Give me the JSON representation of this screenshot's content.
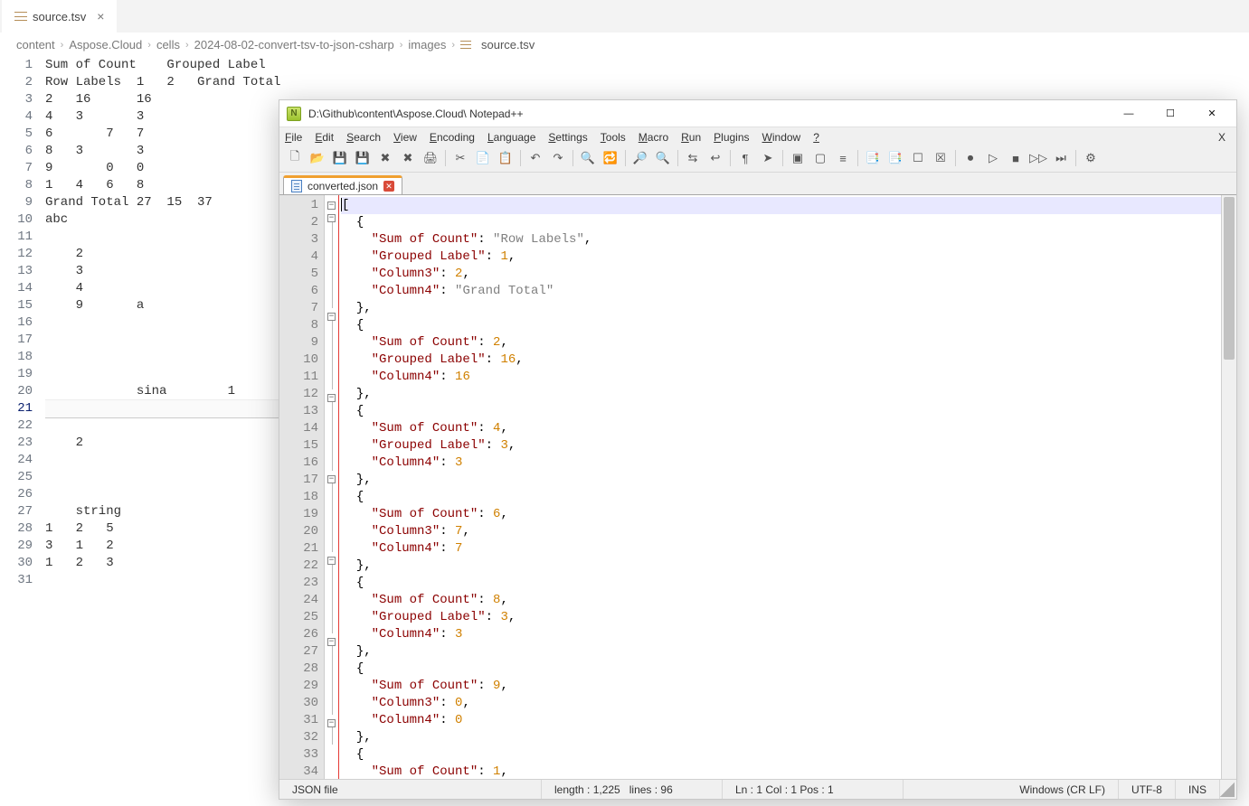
{
  "vscode": {
    "tab_name": "source.tsv",
    "breadcrumbs": [
      "content",
      "Aspose.Cloud",
      "cells",
      "2024-08-02-convert-tsv-to-json-csharp",
      "images",
      "source.tsv"
    ],
    "lines": [
      "Sum of Count    Grouped Label",
      "Row Labels  1   2   Grand Total",
      "2   16      16",
      "4   3       3",
      "6       7   7",
      "8   3       3",
      "9       0   0",
      "1   4   6   8",
      "Grand Total 27  15  37",
      "abc",
      "",
      "    2",
      "    3",
      "    4",
      "    9       a",
      "",
      "",
      "",
      "",
      "            sina        1",
      "",
      "",
      "    2",
      "",
      "",
      "",
      "    string",
      "1   2   5",
      "3   1   2",
      "1   2   3",
      ""
    ],
    "current_line": 21
  },
  "notepad": {
    "title": "D:\\Github\\content\\Aspose.Cloud\\ Notepad++",
    "menus": [
      "File",
      "Edit",
      "Search",
      "View",
      "Encoding",
      "Language",
      "Settings",
      "Tools",
      "Macro",
      "Run",
      "Plugins",
      "Window",
      "?"
    ],
    "tab_name": "converted.json",
    "json_lines": [
      {
        "n": 1,
        "fold": "box",
        "txt": [
          [
            "b",
            "["
          ]
        ]
      },
      {
        "n": 2,
        "fold": "box",
        "txt": [
          [
            "sp",
            "  "
          ],
          [
            "b",
            "{"
          ]
        ]
      },
      {
        "n": 3,
        "fold": "rail",
        "txt": [
          [
            "sp",
            "    "
          ],
          [
            "k",
            "\"Sum of Count\""
          ],
          [
            "p",
            ": "
          ],
          [
            "s",
            "\"Row Labels\""
          ],
          [
            "p",
            ","
          ]
        ]
      },
      {
        "n": 4,
        "fold": "rail",
        "txt": [
          [
            "sp",
            "    "
          ],
          [
            "k",
            "\"Grouped Label\""
          ],
          [
            "p",
            ": "
          ],
          [
            "n",
            "1"
          ],
          [
            "p",
            ","
          ]
        ]
      },
      {
        "n": 5,
        "fold": "rail",
        "txt": [
          [
            "sp",
            "    "
          ],
          [
            "k",
            "\"Column3\""
          ],
          [
            "p",
            ": "
          ],
          [
            "n",
            "2"
          ],
          [
            "p",
            ","
          ]
        ]
      },
      {
        "n": 6,
        "fold": "rail",
        "txt": [
          [
            "sp",
            "    "
          ],
          [
            "k",
            "\"Column4\""
          ],
          [
            "p",
            ": "
          ],
          [
            "s",
            "\"Grand Total\""
          ]
        ]
      },
      {
        "n": 7,
        "fold": "rail",
        "txt": [
          [
            "sp",
            "  "
          ],
          [
            "b",
            "}"
          ],
          [
            "p",
            ","
          ]
        ]
      },
      {
        "n": 8,
        "fold": "box",
        "txt": [
          [
            "sp",
            "  "
          ],
          [
            "b",
            "{"
          ]
        ]
      },
      {
        "n": 9,
        "fold": "rail",
        "txt": [
          [
            "sp",
            "    "
          ],
          [
            "k",
            "\"Sum of Count\""
          ],
          [
            "p",
            ": "
          ],
          [
            "n",
            "2"
          ],
          [
            "p",
            ","
          ]
        ]
      },
      {
        "n": 10,
        "fold": "rail",
        "txt": [
          [
            "sp",
            "    "
          ],
          [
            "k",
            "\"Grouped Label\""
          ],
          [
            "p",
            ": "
          ],
          [
            "n",
            "16"
          ],
          [
            "p",
            ","
          ]
        ]
      },
      {
        "n": 11,
        "fold": "rail",
        "txt": [
          [
            "sp",
            "    "
          ],
          [
            "k",
            "\"Column4\""
          ],
          [
            "p",
            ": "
          ],
          [
            "n",
            "16"
          ]
        ]
      },
      {
        "n": 12,
        "fold": "rail",
        "txt": [
          [
            "sp",
            "  "
          ],
          [
            "b",
            "}"
          ],
          [
            "p",
            ","
          ]
        ]
      },
      {
        "n": 13,
        "fold": "box",
        "txt": [
          [
            "sp",
            "  "
          ],
          [
            "b",
            "{"
          ]
        ]
      },
      {
        "n": 14,
        "fold": "rail",
        "txt": [
          [
            "sp",
            "    "
          ],
          [
            "k",
            "\"Sum of Count\""
          ],
          [
            "p",
            ": "
          ],
          [
            "n",
            "4"
          ],
          [
            "p",
            ","
          ]
        ]
      },
      {
        "n": 15,
        "fold": "rail",
        "txt": [
          [
            "sp",
            "    "
          ],
          [
            "k",
            "\"Grouped Label\""
          ],
          [
            "p",
            ": "
          ],
          [
            "n",
            "3"
          ],
          [
            "p",
            ","
          ]
        ]
      },
      {
        "n": 16,
        "fold": "rail",
        "txt": [
          [
            "sp",
            "    "
          ],
          [
            "k",
            "\"Column4\""
          ],
          [
            "p",
            ": "
          ],
          [
            "n",
            "3"
          ]
        ]
      },
      {
        "n": 17,
        "fold": "rail",
        "txt": [
          [
            "sp",
            "  "
          ],
          [
            "b",
            "}"
          ],
          [
            "p",
            ","
          ]
        ]
      },
      {
        "n": 18,
        "fold": "box",
        "txt": [
          [
            "sp",
            "  "
          ],
          [
            "b",
            "{"
          ]
        ]
      },
      {
        "n": 19,
        "fold": "rail",
        "txt": [
          [
            "sp",
            "    "
          ],
          [
            "k",
            "\"Sum of Count\""
          ],
          [
            "p",
            ": "
          ],
          [
            "n",
            "6"
          ],
          [
            "p",
            ","
          ]
        ]
      },
      {
        "n": 20,
        "fold": "rail",
        "txt": [
          [
            "sp",
            "    "
          ],
          [
            "k",
            "\"Column3\""
          ],
          [
            "p",
            ": "
          ],
          [
            "n",
            "7"
          ],
          [
            "p",
            ","
          ]
        ]
      },
      {
        "n": 21,
        "fold": "rail",
        "txt": [
          [
            "sp",
            "    "
          ],
          [
            "k",
            "\"Column4\""
          ],
          [
            "p",
            ": "
          ],
          [
            "n",
            "7"
          ]
        ]
      },
      {
        "n": 22,
        "fold": "rail",
        "txt": [
          [
            "sp",
            "  "
          ],
          [
            "b",
            "}"
          ],
          [
            "p",
            ","
          ]
        ]
      },
      {
        "n": 23,
        "fold": "box",
        "txt": [
          [
            "sp",
            "  "
          ],
          [
            "b",
            "{"
          ]
        ]
      },
      {
        "n": 24,
        "fold": "rail",
        "txt": [
          [
            "sp",
            "    "
          ],
          [
            "k",
            "\"Sum of Count\""
          ],
          [
            "p",
            ": "
          ],
          [
            "n",
            "8"
          ],
          [
            "p",
            ","
          ]
        ]
      },
      {
        "n": 25,
        "fold": "rail",
        "txt": [
          [
            "sp",
            "    "
          ],
          [
            "k",
            "\"Grouped Label\""
          ],
          [
            "p",
            ": "
          ],
          [
            "n",
            "3"
          ],
          [
            "p",
            ","
          ]
        ]
      },
      {
        "n": 26,
        "fold": "rail",
        "txt": [
          [
            "sp",
            "    "
          ],
          [
            "k",
            "\"Column4\""
          ],
          [
            "p",
            ": "
          ],
          [
            "n",
            "3"
          ]
        ]
      },
      {
        "n": 27,
        "fold": "rail",
        "txt": [
          [
            "sp",
            "  "
          ],
          [
            "b",
            "}"
          ],
          [
            "p",
            ","
          ]
        ]
      },
      {
        "n": 28,
        "fold": "box",
        "txt": [
          [
            "sp",
            "  "
          ],
          [
            "b",
            "{"
          ]
        ]
      },
      {
        "n": 29,
        "fold": "rail",
        "txt": [
          [
            "sp",
            "    "
          ],
          [
            "k",
            "\"Sum of Count\""
          ],
          [
            "p",
            ": "
          ],
          [
            "n",
            "9"
          ],
          [
            "p",
            ","
          ]
        ]
      },
      {
        "n": 30,
        "fold": "rail",
        "txt": [
          [
            "sp",
            "    "
          ],
          [
            "k",
            "\"Column3\""
          ],
          [
            "p",
            ": "
          ],
          [
            "n",
            "0"
          ],
          [
            "p",
            ","
          ]
        ]
      },
      {
        "n": 31,
        "fold": "rail",
        "txt": [
          [
            "sp",
            "    "
          ],
          [
            "k",
            "\"Column4\""
          ],
          [
            "p",
            ": "
          ],
          [
            "n",
            "0"
          ]
        ]
      },
      {
        "n": 32,
        "fold": "rail",
        "txt": [
          [
            "sp",
            "  "
          ],
          [
            "b",
            "}"
          ],
          [
            "p",
            ","
          ]
        ]
      },
      {
        "n": 33,
        "fold": "box",
        "txt": [
          [
            "sp",
            "  "
          ],
          [
            "b",
            "{"
          ]
        ]
      },
      {
        "n": 34,
        "fold": "rail",
        "txt": [
          [
            "sp",
            "    "
          ],
          [
            "k",
            "\"Sum of Count\""
          ],
          [
            "p",
            ": "
          ],
          [
            "n",
            "1"
          ],
          [
            "p",
            ","
          ]
        ]
      }
    ],
    "status": {
      "filetype": "JSON file",
      "length_label": "length : 1,225",
      "lines_label": "lines : 96",
      "pos_label": "Ln : 1   Col : 1   Pos : 1",
      "eol": "Windows (CR LF)",
      "encoding": "UTF-8",
      "ins": "INS"
    },
    "toolbar_icons": [
      "new",
      "open",
      "save",
      "saveall",
      "close",
      "closeall",
      "print",
      "",
      "cut",
      "copy",
      "paste",
      "",
      "undo",
      "redo",
      "",
      "find",
      "replace",
      "",
      "zoomin",
      "zoomout",
      "",
      "sync",
      "wrap",
      "",
      "allchars",
      "indent",
      "",
      "fold",
      "unfold",
      "hidelines",
      "",
      "doc1",
      "doc2",
      "comment",
      "uncomment",
      "",
      "rec",
      "play",
      "stop",
      "ff",
      "ffend",
      "",
      "settings"
    ]
  }
}
